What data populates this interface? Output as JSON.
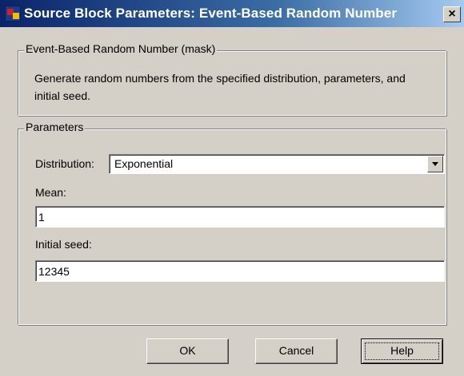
{
  "window": {
    "title": "Source Block Parameters: Event-Based Random Number",
    "close_glyph": "×",
    "app_icon": "simulink-block-icon",
    "colors": {
      "title_bar": "#0a246a",
      "dialog_face": "#d4d0c8"
    }
  },
  "description_group": {
    "legend": "Event-Based Random Number (mask)",
    "text": "Generate random numbers from the specified distribution, parameters, and initial seed."
  },
  "parameters_group": {
    "legend": "Parameters",
    "distribution": {
      "label": "Distribution:",
      "value": "Exponential"
    },
    "mean": {
      "label": "Mean:",
      "value": "1"
    },
    "initial_seed": {
      "label": "Initial seed:",
      "value": "12345"
    }
  },
  "buttons": {
    "ok": "OK",
    "cancel": "Cancel",
    "help": "Help"
  }
}
